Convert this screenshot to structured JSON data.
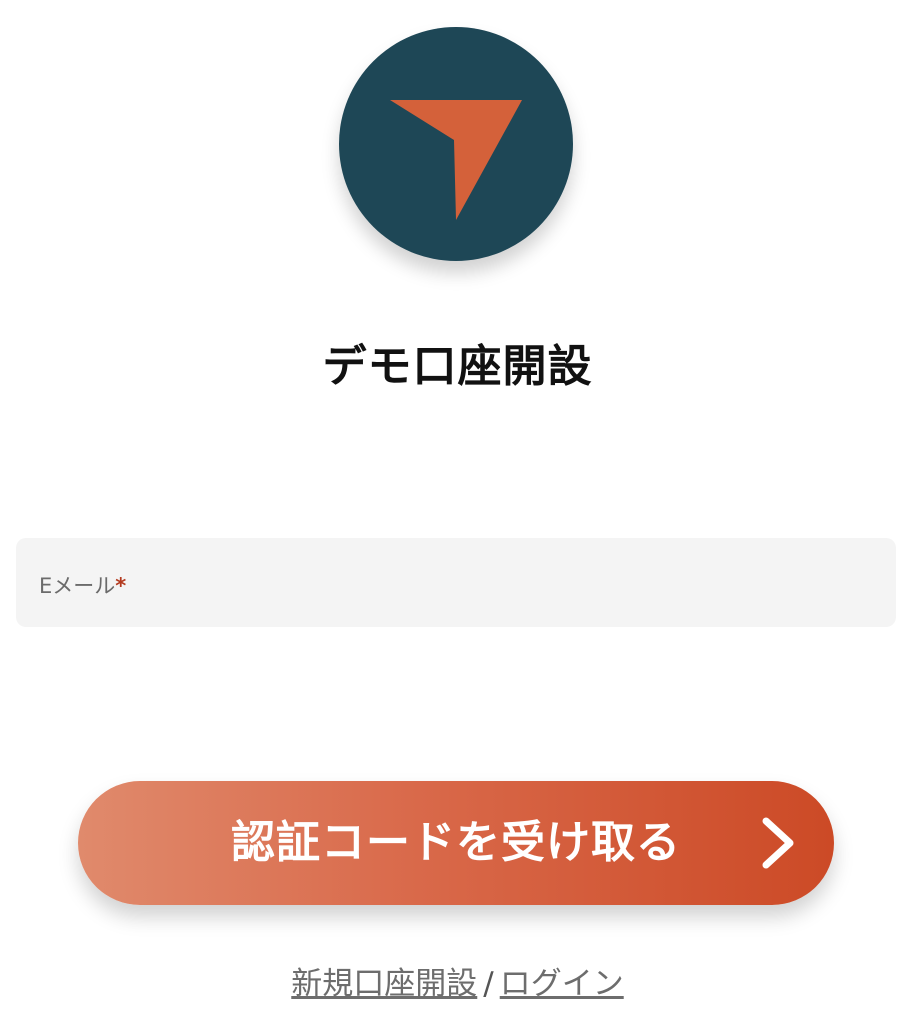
{
  "logo": {
    "icon": "orange-arrow-icon",
    "background_color": "#1e4756",
    "arrow_color": "#d4613a"
  },
  "title": "デモ口座開設",
  "email_field": {
    "label": "Eメール",
    "required_mark": "*",
    "value": ""
  },
  "submit_button": {
    "label": "認証コードを受け取る",
    "icon": "chevron-right-icon",
    "gradient_start": "#e08a6c",
    "gradient_end": "#cc4a26"
  },
  "footer": {
    "signup_link": "新規口座開設",
    "separator": "/",
    "login_link": "ログイン"
  }
}
